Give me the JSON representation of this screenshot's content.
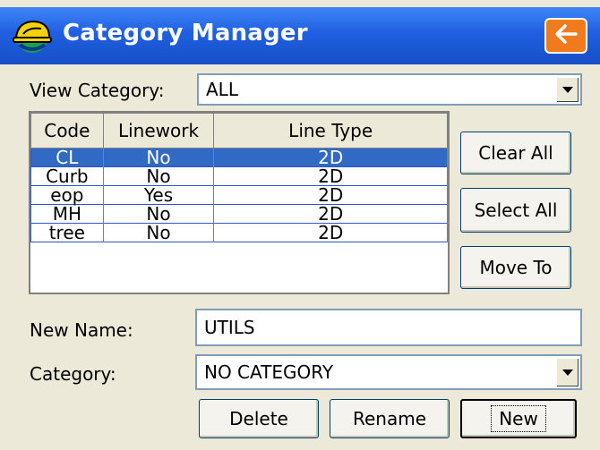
{
  "window": {
    "title": "Category Manager"
  },
  "icons": {
    "app": "hardhat-icon",
    "back": "back-arrow-icon",
    "dropdown": "chevron-down-icon"
  },
  "colors": {
    "titlebar": "#1f5fe0",
    "back_button": "#f07a1e",
    "selection": "#316ac5",
    "face": "#ece9d8"
  },
  "view_category": {
    "label": "View Category:",
    "value": "ALL"
  },
  "table": {
    "columns": [
      "Code",
      "Linework",
      "Line Type"
    ],
    "rows": [
      {
        "code": "CL",
        "linework": "No",
        "line_type": "2D",
        "selected": true
      },
      {
        "code": "Curb",
        "linework": "No",
        "line_type": "2D",
        "selected": false
      },
      {
        "code": "eop",
        "linework": "Yes",
        "line_type": "2D",
        "selected": false
      },
      {
        "code": "MH",
        "linework": "No",
        "line_type": "2D",
        "selected": false
      },
      {
        "code": "tree",
        "linework": "No",
        "line_type": "2D",
        "selected": false
      }
    ]
  },
  "side_buttons": {
    "clear_all": "Clear All",
    "select_all": "Select All",
    "move_to": "Move To"
  },
  "new_name": {
    "label": "New Name:",
    "value": "UTILS"
  },
  "category": {
    "label": "Category:",
    "value": "NO CATEGORY"
  },
  "bottom_buttons": {
    "delete": "Delete",
    "rename": "Rename",
    "new": "New"
  }
}
